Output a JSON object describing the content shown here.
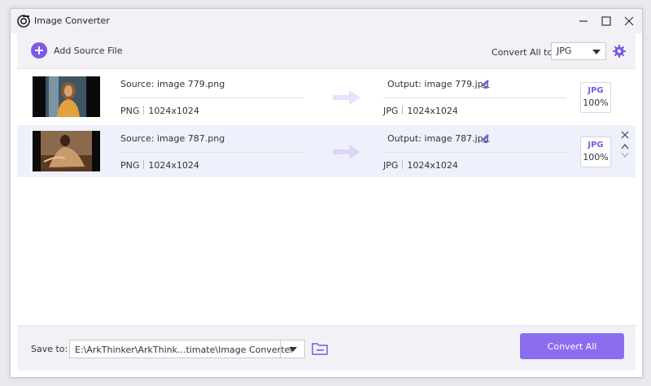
{
  "window": {
    "title": "Image Converter"
  },
  "toolbar": {
    "add_label": "Add Source File",
    "convert_all_to_label": "Convert All to:",
    "format_value": "JPG"
  },
  "files": [
    {
      "source_name": "Source: image 779.png",
      "source_format": "PNG",
      "source_size": "1024x1024",
      "output_name": "Output: image 779.jpg",
      "output_format": "JPG",
      "output_size": "1024x1024",
      "target_format": "JPG",
      "quality": "100%"
    },
    {
      "source_name": "Source: image 787.png",
      "source_format": "PNG",
      "source_size": "1024x1024",
      "output_name": "Output: image 787.jpg",
      "output_format": "JPG",
      "output_size": "1024x1024",
      "target_format": "JPG",
      "quality": "100%"
    }
  ],
  "bottom": {
    "save_label": "Save to:",
    "save_path": "E:\\ArkThinker\\ArkThink...timate\\Image Converter",
    "convert_button": "Convert All"
  },
  "colors": {
    "accent": "#7b5ae6",
    "button": "#8c6cef",
    "selected_row": "#eef0fb"
  }
}
